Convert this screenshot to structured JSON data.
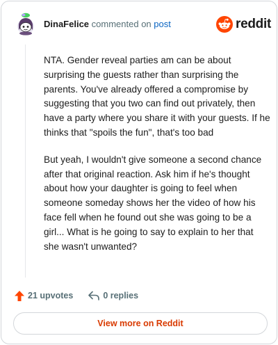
{
  "header": {
    "username": "DinaFelice",
    "action_text": "commented on",
    "post_link": "post",
    "brand_wordmark": "reddit",
    "avatar_icon": "snoo-avatar-icon",
    "logo_icon": "reddit-snoo-icon"
  },
  "comment": {
    "paragraphs": [
      "NTA. Gender reveal parties am can be about surprising the guests rather than surprising the parents. You've already offered a compromise by suggesting that you two can find out privately, then have a party where you share it with your guests. If he thinks that \"spoils the fun\", that's too bad",
      "But yeah, I wouldn't give someone a second chance after that original reaction. Ask him if he's thought about how your daughter is going to feel when someone someday shows her the video of how his face fell when he found out she was going to be a girl... What is he going to say to explain to her that she wasn't unwanted?"
    ]
  },
  "actions": {
    "upvotes": "21 upvotes",
    "replies": "0 replies",
    "upvote_icon": "upvote-arrow-icon",
    "reply_icon": "reply-arrow-icon"
  },
  "footer": {
    "view_more_label": "View more on Reddit"
  },
  "colors": {
    "brand": "#ff4500",
    "link": "#0a65c2",
    "view_more": "#d93a00",
    "meta_text": "#576f76"
  }
}
